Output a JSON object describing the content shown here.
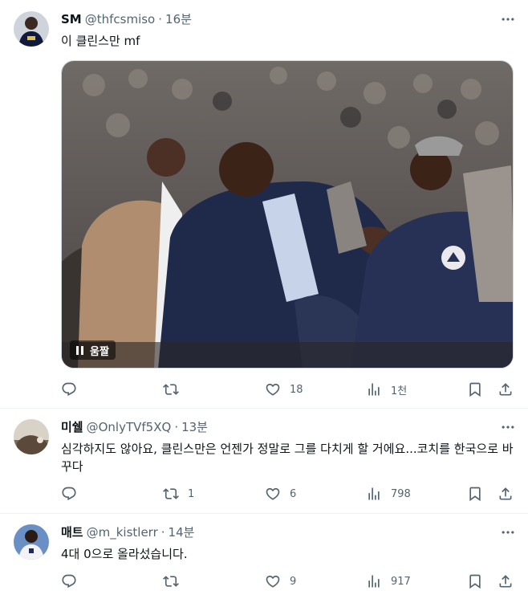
{
  "tweets": [
    {
      "name": "SM",
      "handle": "@thfcsmiso",
      "time": "16분",
      "text": "이 클린스만 mf",
      "media": {
        "type": "gif",
        "badge_label": "움짤"
      },
      "actions": {
        "reply": "",
        "retweet": "",
        "like": "18",
        "views": "1천"
      }
    },
    {
      "name": "미쉘",
      "handle": "@OnlyTVf5XQ",
      "time": "13분",
      "text": "심각하지도 않아요, 클린스만은 언젠가 정말로 그를 다치게 할 거에요...코치를 한국으로 바꾸다",
      "actions": {
        "reply": "",
        "retweet": "1",
        "like": "6",
        "views": "798"
      }
    },
    {
      "name": "매트",
      "handle": "@m_kistlerr",
      "time": "14분",
      "text": "4대 0으로 올라섰습니다.",
      "actions": {
        "reply": "",
        "retweet": "",
        "like": "9",
        "views": "917"
      }
    }
  ],
  "colors": {
    "text": "#0f1419",
    "secondary": "#536471",
    "divider": "#eff3f4"
  },
  "icons": [
    "more-icon",
    "reply-icon",
    "retweet-icon",
    "like-icon",
    "views-icon",
    "bookmark-icon",
    "share-icon",
    "pause-icon"
  ]
}
